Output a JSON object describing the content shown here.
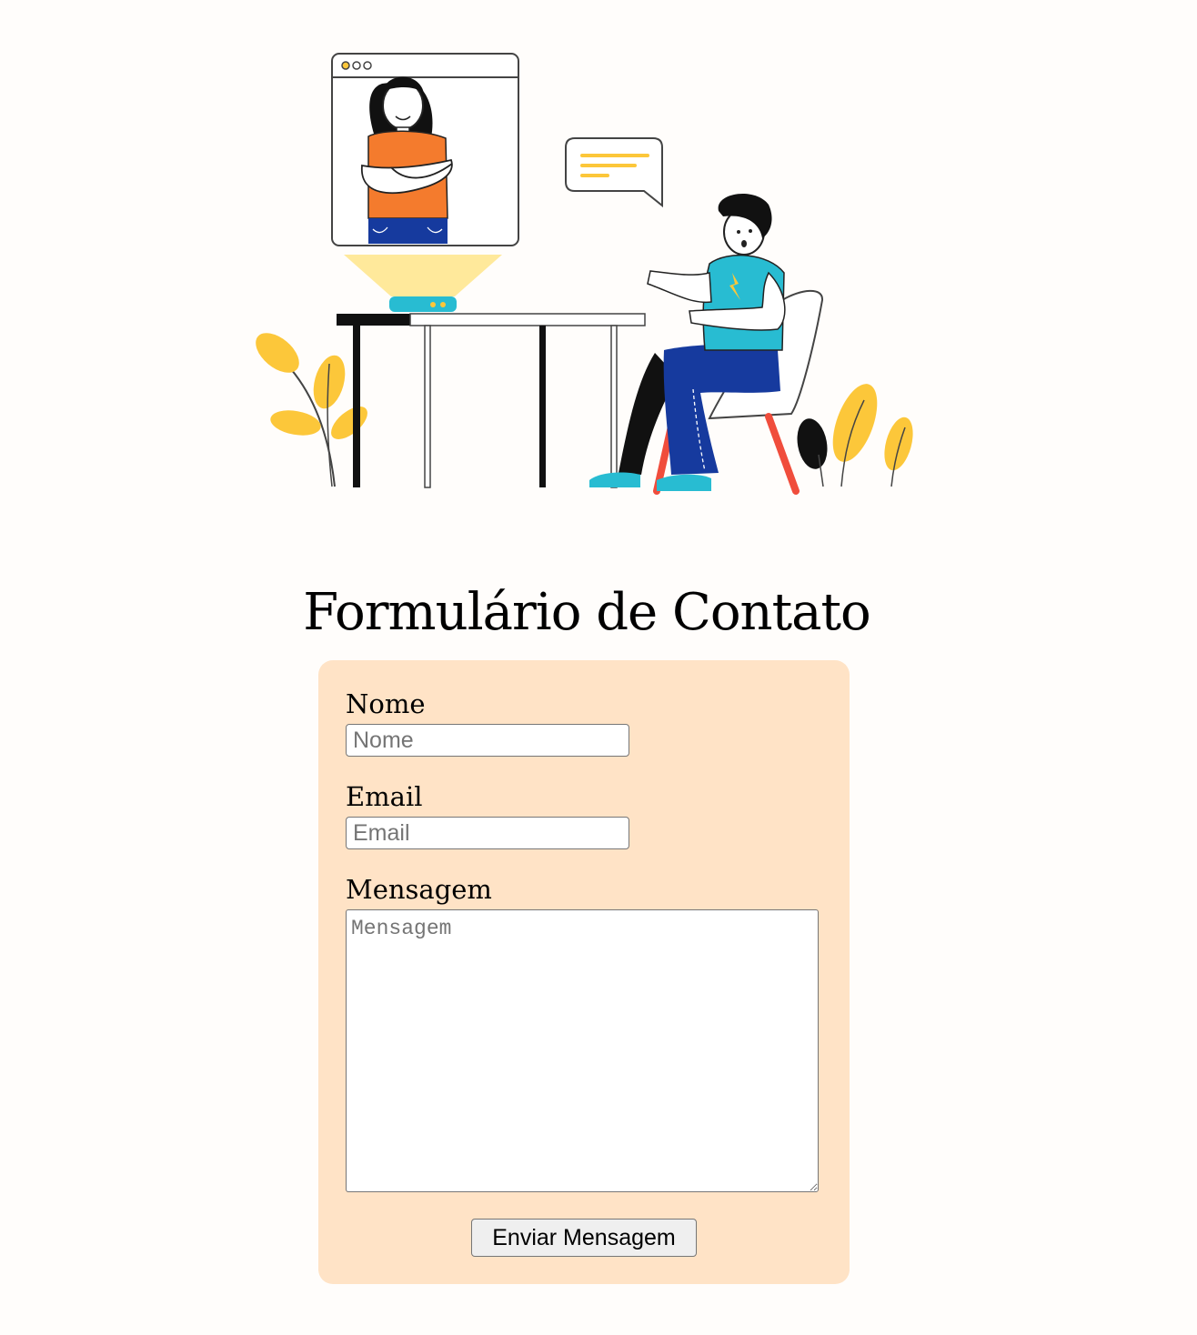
{
  "page": {
    "title": "Formulário de Contato"
  },
  "illustration": {
    "name": "video-call-illustration",
    "colors": {
      "yellow": "#fcc73a",
      "orange": "#f47b2d",
      "teal": "#28bcd2",
      "blue": "#163a9e",
      "red": "#f04d3c",
      "black": "#111111"
    }
  },
  "form": {
    "background_color": "#ffe3c6",
    "name_label": "Nome",
    "name_placeholder": "Nome",
    "email_label": "Email",
    "email_placeholder": "Email",
    "message_label": "Mensagem",
    "message_placeholder": "Mensagem",
    "submit_label": "Enviar Mensagem"
  }
}
